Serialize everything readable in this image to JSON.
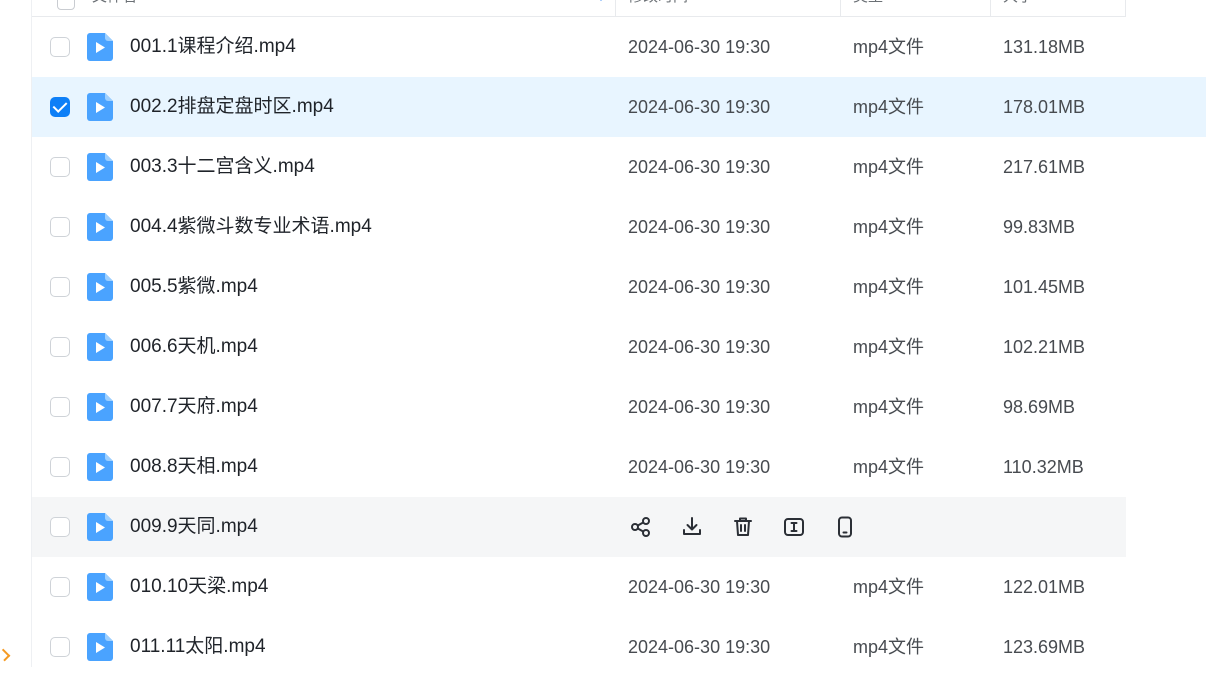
{
  "header": {
    "col_name": "文件名",
    "col_modified": "修改时间",
    "col_type": "类型",
    "col_size": "大小"
  },
  "accent_color": "#0d7ff7",
  "files": [
    {
      "name": "001.1课程介绍.mp4",
      "modified": "2024-06-30 19:30",
      "type": "mp4文件",
      "size": "131.18MB",
      "selected": false,
      "hover": false
    },
    {
      "name": "002.2排盘定盘时区.mp4",
      "modified": "2024-06-30 19:30",
      "type": "mp4文件",
      "size": "178.01MB",
      "selected": true,
      "hover": false
    },
    {
      "name": "003.3十二宫含义.mp4",
      "modified": "2024-06-30 19:30",
      "type": "mp4文件",
      "size": "217.61MB",
      "selected": false,
      "hover": false
    },
    {
      "name": "004.4紫微斗数专业术语.mp4",
      "modified": "2024-06-30 19:30",
      "type": "mp4文件",
      "size": "99.83MB",
      "selected": false,
      "hover": false
    },
    {
      "name": "005.5紫微.mp4",
      "modified": "2024-06-30 19:30",
      "type": "mp4文件",
      "size": "101.45MB",
      "selected": false,
      "hover": false
    },
    {
      "name": "006.6天机.mp4",
      "modified": "2024-06-30 19:30",
      "type": "mp4文件",
      "size": "102.21MB",
      "selected": false,
      "hover": false
    },
    {
      "name": "007.7天府.mp4",
      "modified": "2024-06-30 19:30",
      "type": "mp4文件",
      "size": "98.69MB",
      "selected": false,
      "hover": false
    },
    {
      "name": "008.8天相.mp4",
      "modified": "2024-06-30 19:30",
      "type": "mp4文件",
      "size": "110.32MB",
      "selected": false,
      "hover": false
    },
    {
      "name": "009.9天同.mp4",
      "modified": "",
      "type": "",
      "size": "",
      "selected": false,
      "hover": true
    },
    {
      "name": "010.10天梁.mp4",
      "modified": "2024-06-30 19:30",
      "type": "mp4文件",
      "size": "122.01MB",
      "selected": false,
      "hover": false
    },
    {
      "name": "011.11太阳.mp4",
      "modified": "2024-06-30 19:30",
      "type": "mp4文件",
      "size": "123.69MB",
      "selected": false,
      "hover": false
    }
  ],
  "hover_actions": [
    {
      "name": "share-icon"
    },
    {
      "name": "download-icon"
    },
    {
      "name": "delete-icon"
    },
    {
      "name": "rename-icon"
    },
    {
      "name": "phone-icon"
    }
  ]
}
